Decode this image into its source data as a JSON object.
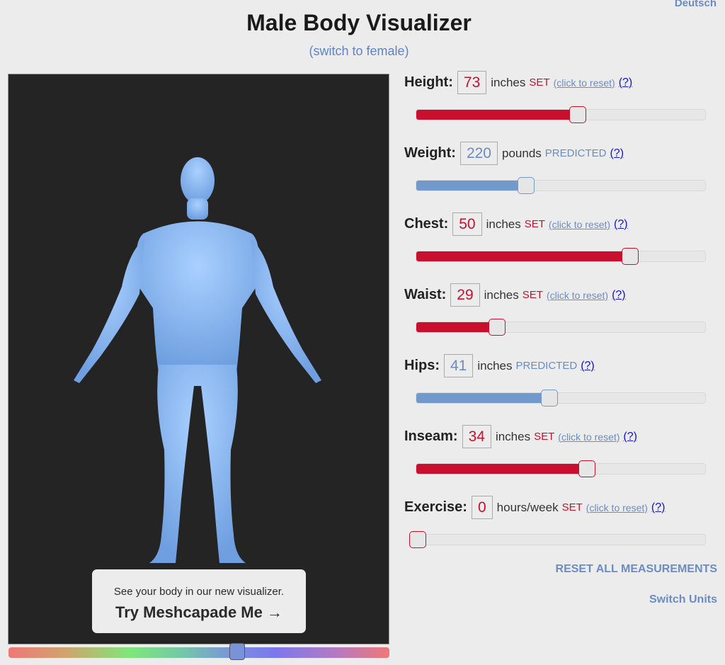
{
  "language_link": "Deutsch",
  "title": "Male Body Visualizer",
  "switch_sex": "(switch to female)",
  "promo": {
    "line1": "See your body in our new visualizer.",
    "line2": "Try Meshcapade Me",
    "arrow": "→"
  },
  "color_slider": {
    "value_fraction": 0.6
  },
  "colors": {
    "set": "#c8102e",
    "predicted": "#6b8cc2",
    "body": "#8ab4f0",
    "viewer_bg": "#242424"
  },
  "measurements": [
    {
      "label": "Height:",
      "value": "73",
      "unit": "inches",
      "status": "SET",
      "reset": "(click to reset)",
      "help": "(?)",
      "fraction": 0.56
    },
    {
      "label": "Weight:",
      "value": "220",
      "unit": "pounds",
      "status": "PREDICTED",
      "reset": "",
      "help": "(?)",
      "fraction": 0.38
    },
    {
      "label": "Chest:",
      "value": "50",
      "unit": "inches",
      "status": "SET",
      "reset": "(click to reset)",
      "help": "(?)",
      "fraction": 0.74
    },
    {
      "label": "Waist:",
      "value": "29",
      "unit": "inches",
      "status": "SET",
      "reset": "(click to reset)",
      "help": "(?)",
      "fraction": 0.28
    },
    {
      "label": "Hips:",
      "value": "41",
      "unit": "inches",
      "status": "PREDICTED",
      "reset": "",
      "help": "(?)",
      "fraction": 0.46
    },
    {
      "label": "Inseam:",
      "value": "34",
      "unit": "inches",
      "status": "SET",
      "reset": "(click to reset)",
      "help": "(?)",
      "fraction": 0.59
    },
    {
      "label": "Exercise:",
      "value": "0",
      "unit": "hours/week",
      "status": "SET",
      "reset": "(click to reset)",
      "help": "(?)",
      "fraction": 0.0
    }
  ],
  "reset_all": "RESET ALL MEASUREMENTS",
  "switch_units": "Switch Units"
}
